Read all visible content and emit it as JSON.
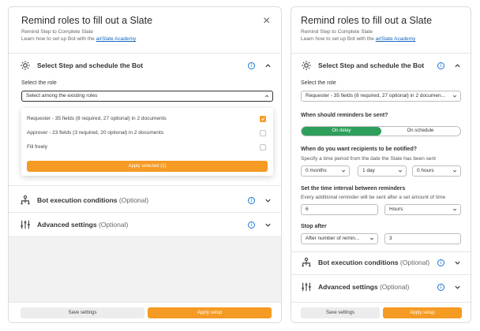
{
  "left": {
    "title": "Remind roles to fill out a Slate",
    "subtitle": "Remind Step to Complete Slate",
    "learn_prefix": "Learn how to set up Bot with the ",
    "learn_link": "airSlate Academy",
    "section_step": "Select Step and schedule the Bot",
    "role_label": "Select the role",
    "role_placeholder": "Select among the existing roles",
    "options": [
      {
        "label": "Requester - 35 fields (8 required, 27 optional) in 2 documents",
        "checked": true
      },
      {
        "label": "Approver - 23 fields (3 required, 20 optional) in 2 documents",
        "checked": false
      },
      {
        "label": "Fill freely",
        "checked": false
      }
    ],
    "apply_selected": "Apply selected (1)",
    "section_exec": "Bot execution conditions",
    "section_exec_opt": "(Optional)",
    "section_adv": "Advanced settings",
    "section_adv_opt": "(Optional)",
    "save_settings": "Save settings",
    "apply_setup": "Apply setup"
  },
  "right": {
    "title": "Remind roles to fill out a Slate",
    "subtitle": "Remind Step to Complete Slate",
    "learn_prefix": "Learn how to set up Bot with the ",
    "learn_link": "airSlate Academy",
    "section_step": "Select Step and schedule the Bot",
    "role_label": "Select the role",
    "role_value": "Requester - 35 fields (8 required, 27 optional) in 2 documen...",
    "when_label": "When should reminders be sent?",
    "toggle_on": "On delay",
    "toggle_off": "On schedule",
    "notify_label": "When do you want recipients to be notified?",
    "notify_hint": "Specify a time period from the date the Slate has been sent",
    "months_value": "0 months",
    "day_value": "1 day",
    "hours_value": "0 hours",
    "interval_label": "Set the time interval between reminders",
    "interval_hint": "Every additional reminder will be sent after a set amount of time",
    "interval_value": "6",
    "interval_unit": "Hours",
    "stop_label": "Stop after",
    "stop_mode": "After number of remin...",
    "stop_value": "3",
    "section_exec": "Bot execution conditions",
    "section_exec_opt": "(Optional)",
    "section_adv": "Advanced settings",
    "section_adv_opt": "(Optional)",
    "save_settings": "Save settings",
    "apply_setup": "Apply setup"
  },
  "colors": {
    "accent": "#f59a23",
    "toggle_active": "#2e9e5b",
    "info": "#1976d2",
    "link": "#1565c0"
  },
  "icons": {
    "close": "close-icon",
    "gear": "gear-icon",
    "info": "info-icon",
    "chevron_up": "chevron-up-icon",
    "chevron_down": "chevron-down-icon",
    "hierarchy": "hierarchy-icon",
    "sliders": "sliders-icon"
  }
}
